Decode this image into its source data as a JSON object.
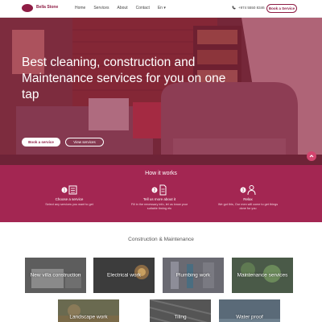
{
  "header": {
    "brand": "Bella Stone",
    "nav": [
      "Home",
      "Services",
      "About",
      "Contact",
      "En ▾"
    ],
    "phone": "+974 5550 8346",
    "book_label": "Book a Service"
  },
  "hero": {
    "title_part1": "Best ",
    "title_bold1": "cleaning, construction and Maintenance",
    "title_part2": " services for you on one tap",
    "btn_service": "Book a service",
    "btn_view": "View services"
  },
  "how": {
    "title": "How it works",
    "steps": [
      {
        "title": "Choose a service",
        "desc": "Select any services you want to get",
        "icon": "list-card-icon"
      },
      {
        "title": "Tell us more about it",
        "desc": "Fill in the necessary info, let us know your suitable timing etc",
        "icon": "document-icon"
      },
      {
        "title": "Relax",
        "desc": "We got this, Our men will come to get things done for you",
        "icon": "worker-icon"
      }
    ]
  },
  "services": {
    "title": "Construction & Maintenance",
    "tiles": [
      {
        "label": "New villa construction"
      },
      {
        "label": "Electrical work"
      },
      {
        "label": "Plumbing work"
      },
      {
        "label": "Maintenance services"
      },
      {
        "label": "Landscape work"
      },
      {
        "label": "Tiling"
      },
      {
        "label": "Water proof"
      }
    ]
  },
  "colors": {
    "brand": "#8f1d45",
    "section": "#a32652"
  }
}
